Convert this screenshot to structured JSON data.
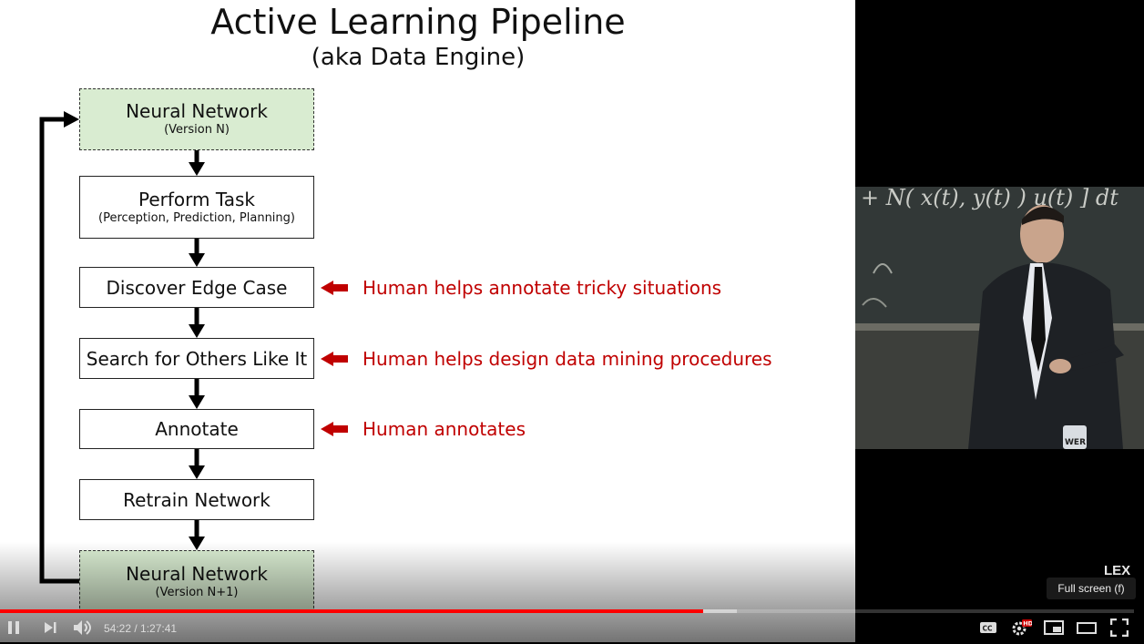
{
  "slide": {
    "title": "Active Learning Pipeline",
    "subtitle": "(aka Data Engine)",
    "steps": [
      {
        "label": "Neural Network",
        "sub": "(Version N)"
      },
      {
        "label": "Perform Task",
        "sub": "(Perception, Prediction, Planning)"
      },
      {
        "label": "Discover Edge Case",
        "sub": ""
      },
      {
        "label": "Search for Others Like It",
        "sub": ""
      },
      {
        "label": "Annotate",
        "sub": ""
      },
      {
        "label": "Retrain Network",
        "sub": ""
      },
      {
        "label": "Neural Network",
        "sub": "(Version N+1)"
      }
    ],
    "notes": [
      "Human helps annotate tricky situations",
      "Human helps design data mining procedures",
      "Human annotates"
    ]
  },
  "inset": {
    "chalkboard_text": "+ N( x(t), y(t) ) u(t) ] dt",
    "bottle_label": "WER"
  },
  "overlay": {
    "watermark": "LEX",
    "tooltip": "Full screen (f)"
  },
  "player": {
    "current_time": "54:22",
    "separator": " / ",
    "duration": "1:27:41",
    "progress_fraction": 0.62,
    "buffered_fraction": 0.65,
    "accent_color": "#ff0000",
    "icons": [
      "pause-icon",
      "next-icon",
      "volume-icon",
      "captions-icon",
      "settings-icon",
      "hd-badge",
      "miniplayer-icon",
      "theater-icon",
      "fullscreen-icon"
    ],
    "hd_badge": "HD",
    "cc_label": "CC"
  },
  "colors": {
    "annotation_red": "#c00000",
    "network_box_green": "#d9ecd1"
  }
}
